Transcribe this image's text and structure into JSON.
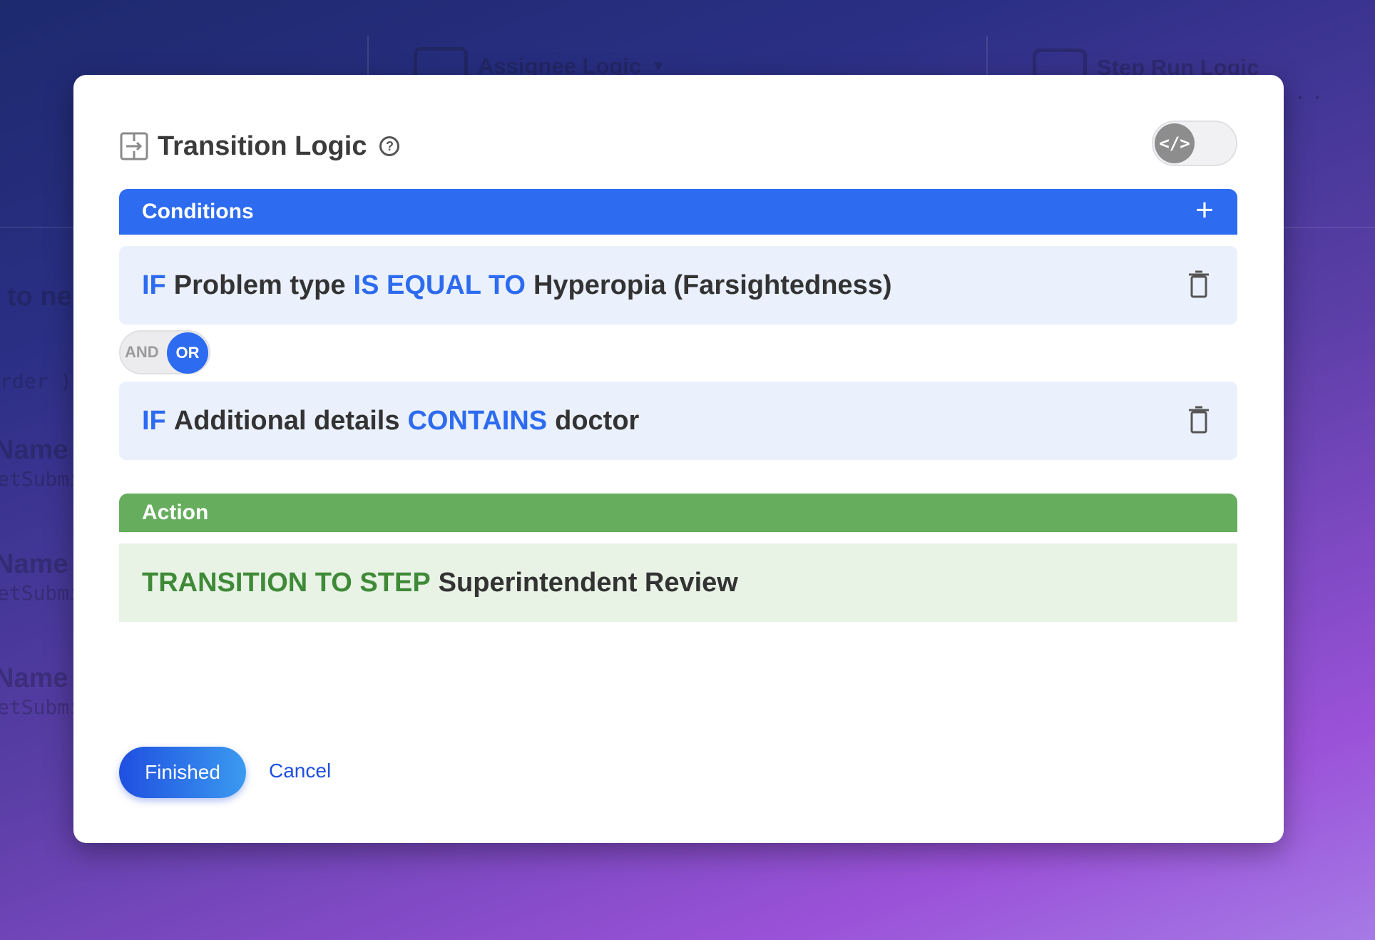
{
  "background": {
    "tabs": [
      {
        "label": "Assignee Logic"
      },
      {
        "label": "Step Run Logic"
      }
    ],
    "ellipsis": "...",
    "fragments": {
      "to_ne": "to ne",
      "rder": "rder )",
      "name": "Name",
      "mono": "etSubmi"
    }
  },
  "modal": {
    "title": "Transition Logic",
    "help_icon": "?",
    "code_toggle_glyph": "</>",
    "conditions": {
      "header": "Conditions",
      "add_icon": "+",
      "rows": [
        {
          "if": "IF",
          "field": "Problem type",
          "operator": "IS EQUAL TO",
          "value": "Hyperopia (Farsightedness)"
        },
        {
          "if": "IF",
          "field": "Additional details",
          "operator": "CONTAINS",
          "value": "doctor"
        }
      ],
      "logic_toggle": {
        "and": "AND",
        "or": "OR",
        "selected": "OR"
      }
    },
    "action": {
      "header": "Action",
      "keyword": "TRANSITION TO STEP",
      "target": "Superintendent Review"
    },
    "buttons": {
      "finished": "Finished",
      "cancel": "Cancel"
    }
  },
  "colors": {
    "conditions_bar": "#2d6bf0",
    "action_bar": "#66ad5e",
    "keyword_blue": "#2d6bf0",
    "keyword_green": "#3f8a37"
  },
  "icons": [
    "transition-icon",
    "help-icon",
    "code-icon",
    "plus-icon",
    "trash-icon"
  ]
}
